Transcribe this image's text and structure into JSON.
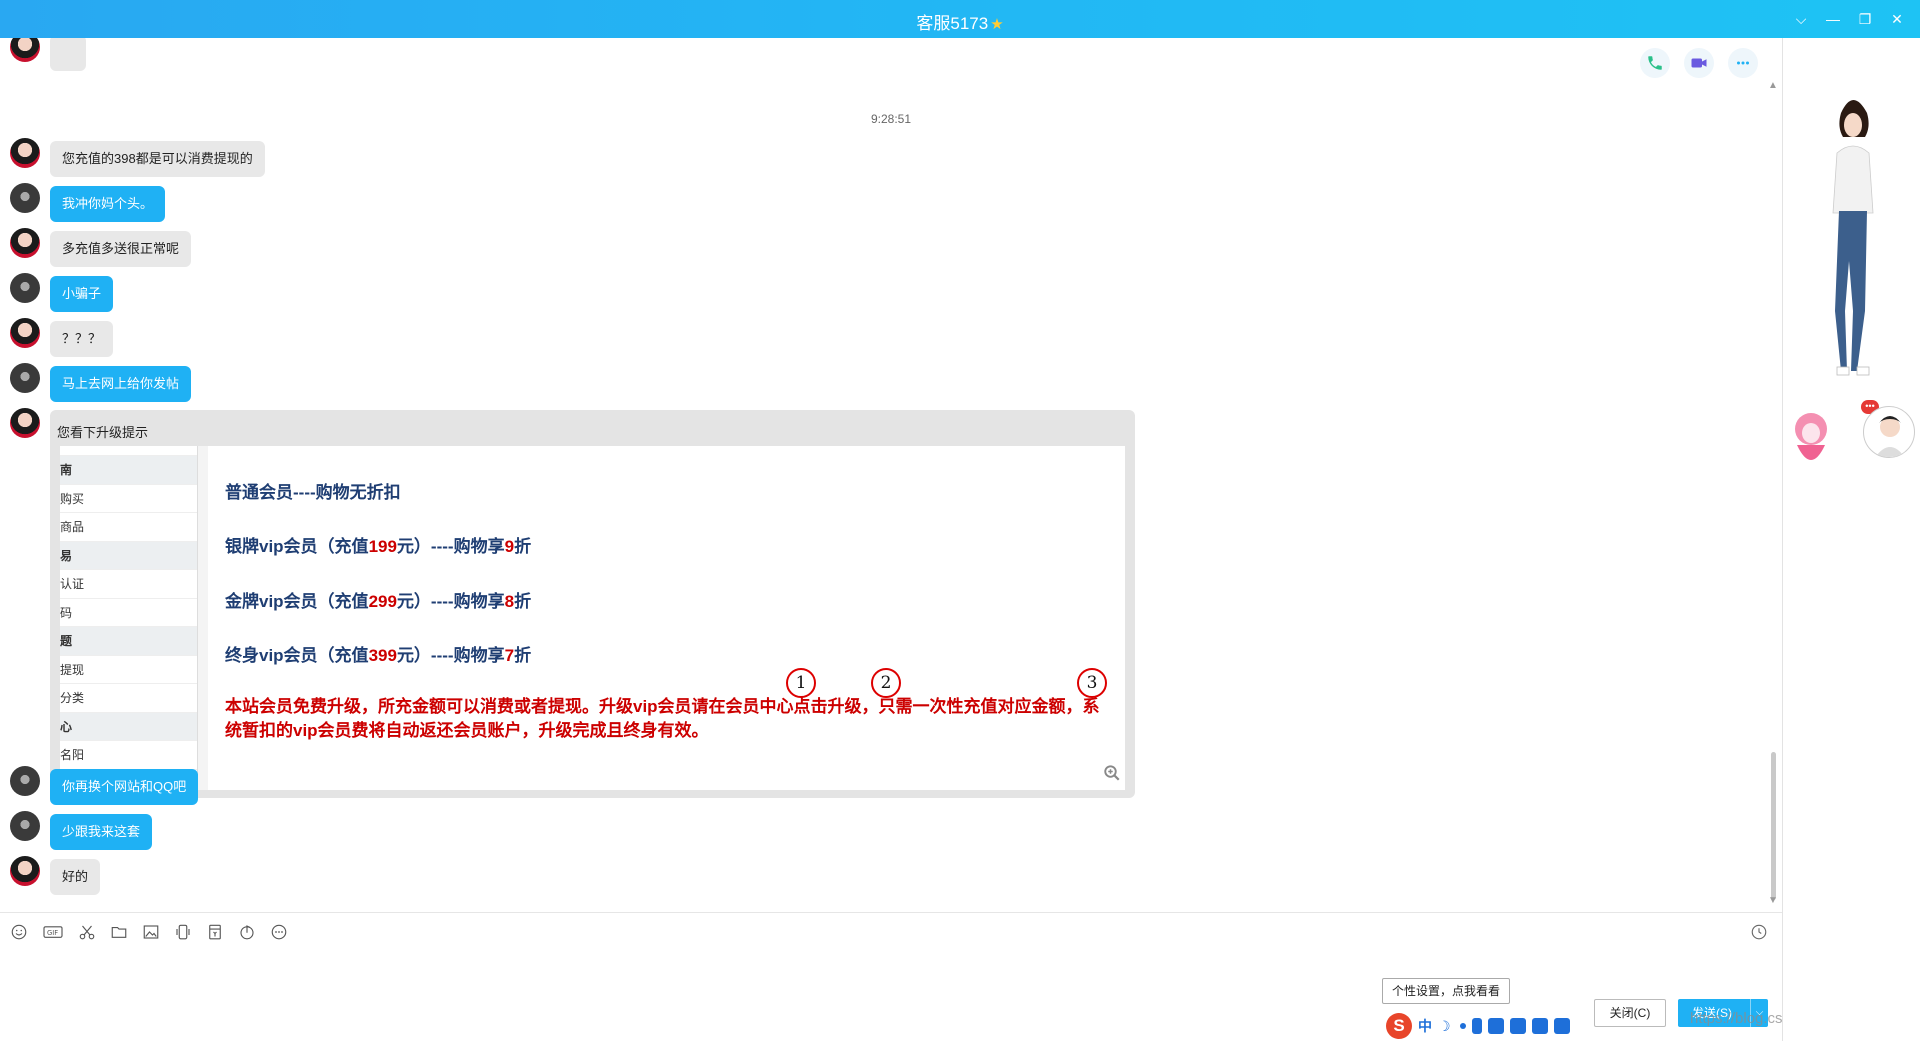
{
  "window": {
    "title": "客服5173",
    "star": "★",
    "controls": {
      "dropdown": "⌵",
      "minimize": "—",
      "restore": "❐",
      "close": "✕"
    }
  },
  "chat": {
    "timestamp": "9:28:51",
    "messages": [
      {
        "side": "in",
        "text": "您充值的398都是可以消费提现的"
      },
      {
        "side": "out",
        "text": "我冲你妈个头。"
      },
      {
        "side": "in",
        "text": "多充值多送很正常呢"
      },
      {
        "side": "out",
        "text": "小骗子"
      },
      {
        "side": "in",
        "text": "？？？"
      },
      {
        "side": "out",
        "text": "马上去网上给你发帖"
      },
      {
        "side": "out",
        "text": "你再换个网站和QQ吧"
      },
      {
        "side": "out",
        "text": "少跟我来这套"
      },
      {
        "side": "in",
        "text": "好的"
      }
    ],
    "image_message": {
      "caption": "您看下升级提示",
      "sidenav": [
        "南",
        "购买",
        "商品",
        "易",
        "认证",
        "码",
        "题",
        "提现",
        "分类",
        "心",
        "名阳"
      ],
      "lines": {
        "l1": "普通会员----购物无折扣",
        "l2a": "银牌vip会员（充值",
        "l2b": "199",
        "l2c": "元）----购物享",
        "l2d": "9",
        "l2e": "折",
        "l3a": "金牌vip会员（充值",
        "l3b": "299",
        "l3c": "元）----购物享",
        "l3d": "8",
        "l3e": "折",
        "l4a": "终身vip会员（充值",
        "l4b": "399",
        "l4c": "元）----购物享",
        "l4d": "7",
        "l4e": "折",
        "red": "本站会员免费升级，所充金额可以消费或者提现。升级vip会员请在会员中心点击升级，只需一次性充值对应金额，系统暂扣的vip会员费将自动返还会员账户，升级完成且终身有效。"
      },
      "markers": [
        "1",
        "2",
        "3"
      ]
    }
  },
  "input": {
    "tooltip": "个性设置，点我看看",
    "ime": {
      "logo": "S",
      "lang": "中",
      "moon": "☽"
    },
    "close_label": "关闭(C)",
    "send_label": "发送(S)",
    "send_arrow": "⌵",
    "watermark": "https://blog.csdn.net/g338328"
  },
  "colors": {
    "accent": "#1fb1f4",
    "titlebar": "#22b7f4",
    "warning_red": "#cc0000",
    "navy": "#1f3e73"
  }
}
